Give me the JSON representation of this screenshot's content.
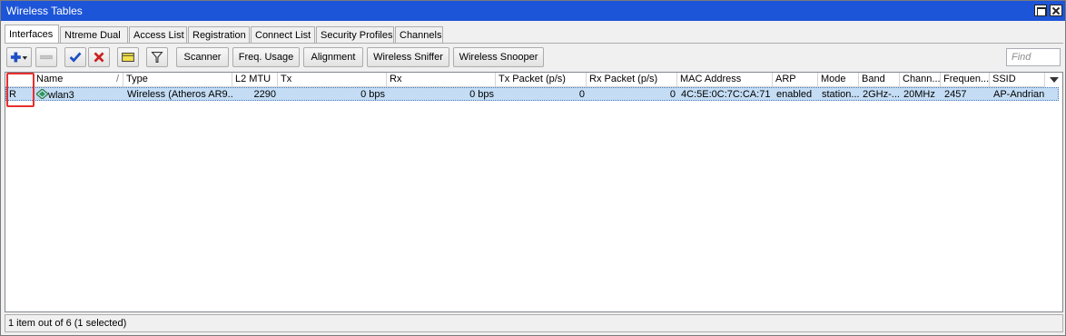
{
  "window": {
    "title": "Wireless Tables"
  },
  "tabs": [
    {
      "label": "Interfaces",
      "active": true
    },
    {
      "label": "Ntreme Dual"
    },
    {
      "label": "Access List"
    },
    {
      "label": "Registration"
    },
    {
      "label": "Connect List"
    },
    {
      "label": "Security Profiles"
    },
    {
      "label": "Channels"
    }
  ],
  "toolbar": {
    "icons": [
      "add-icon",
      "remove-icon",
      "enable-check-icon",
      "disable-x-icon",
      "comment-icon",
      "filter-icon"
    ],
    "buttons": [
      "Scanner",
      "Freq. Usage",
      "Alignment",
      "Wireless Sniffer",
      "Wireless Snooper"
    ],
    "find_placeholder": "Find"
  },
  "colors": {
    "titlebar": "#1d55d8",
    "selected_row": "#c4ddf5",
    "highlight_box": "#e53030",
    "add_blue": "#1f4fc4",
    "check_blue": "#1f4fc4",
    "x_red": "#cc2020"
  },
  "table": {
    "columns": [
      "",
      "Name",
      "Type",
      "L2 MTU",
      "Tx",
      "Rx",
      "Tx Packet (p/s)",
      "Rx Packet (p/s)",
      "MAC Address",
      "ARP",
      "Mode",
      "Band",
      "Chann...",
      "Frequen...",
      "SSID"
    ],
    "sort_indicator": "/",
    "rows": [
      {
        "flag": "R",
        "name": "wlan3",
        "type": "Wireless (Atheros AR9...",
        "l2mtu": "2290",
        "tx": "0 bps",
        "rx": "0 bps",
        "tx_packet": "0",
        "rx_packet": "0",
        "mac": "4C:5E:0C:7C:CA:71",
        "arp": "enabled",
        "mode": "station...",
        "band": "2GHz-...",
        "channel": "20MHz",
        "frequency": "2457",
        "ssid": "AP-Andrian",
        "selected": true
      }
    ]
  },
  "status": {
    "text": "1 item out of 6 (1 selected)"
  }
}
